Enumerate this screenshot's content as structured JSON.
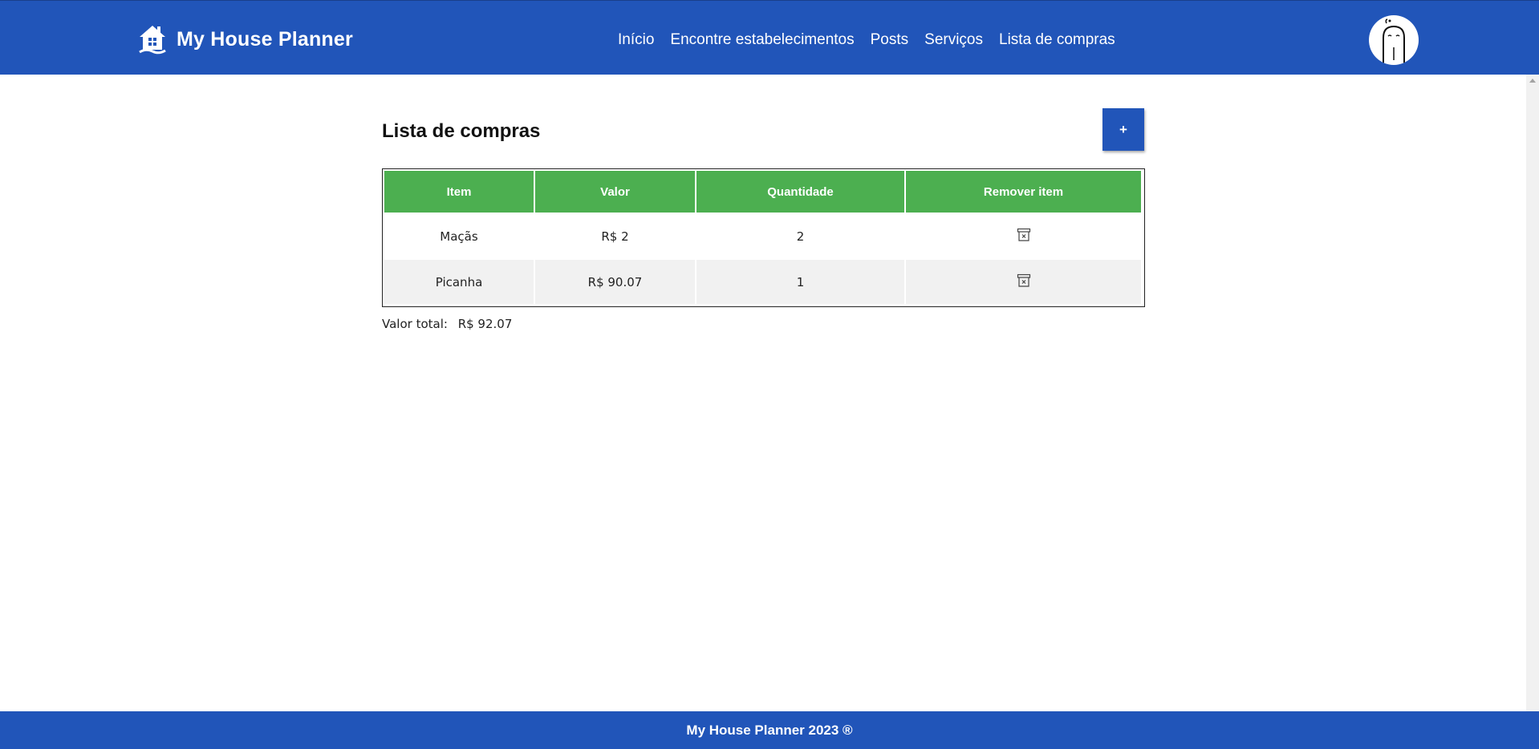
{
  "brand": {
    "name": "My House Planner",
    "logo_icon": "house-icon"
  },
  "nav": {
    "items": [
      {
        "label": "Início"
      },
      {
        "label": "Encontre estabelecimentos"
      },
      {
        "label": "Posts"
      },
      {
        "label": "Serviços"
      },
      {
        "label": "Lista de compras"
      }
    ],
    "avatar_icon": "avatar"
  },
  "main": {
    "title": "Lista de compras",
    "add_button_label": "+",
    "table": {
      "headers": [
        "Item",
        "Valor",
        "Quantidade",
        "Remover item"
      ],
      "rows": [
        {
          "item": "Maçãs",
          "valor": "R$ 2",
          "quantidade": "2",
          "remove_icon": "trash-icon"
        },
        {
          "item": "Picanha",
          "valor": "R$ 90.07",
          "quantidade": "1",
          "remove_icon": "trash-icon"
        }
      ]
    },
    "total": {
      "label": "Valor total:",
      "value": "R$ 92.07"
    }
  },
  "footer": {
    "text": "My House Planner 2023 ®"
  },
  "colors": {
    "primary": "#2155b9",
    "table_header": "#4caf50",
    "row_alt": "#f1f1f1"
  }
}
